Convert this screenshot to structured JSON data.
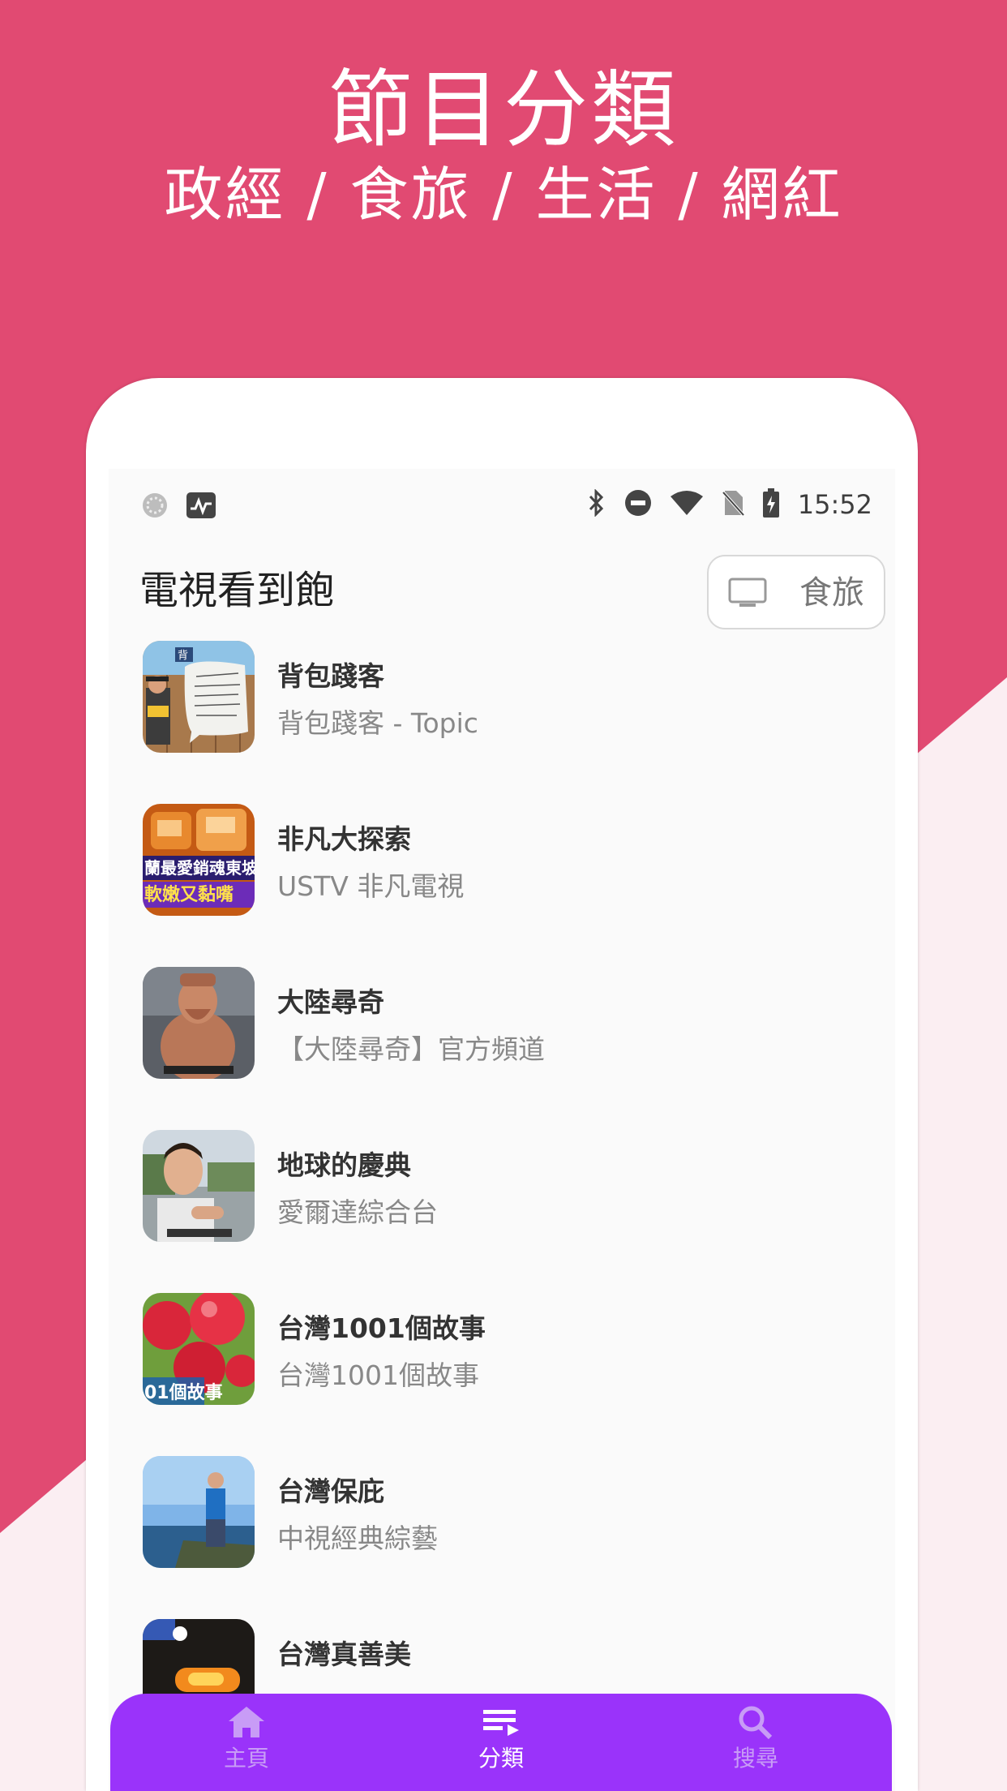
{
  "promo": {
    "title": "節目分類",
    "subtitle": "政經 / 食旅 / 生活 / 網紅"
  },
  "colors": {
    "brand_pink": "#e14a72",
    "light_pink": "#fbeef2",
    "nav_purple": "#9a33fa",
    "nav_inactive": "#c89cf6"
  },
  "status_bar": {
    "time": "15:52",
    "icons": [
      "sync-icon",
      "activity-icon",
      "bluetooth-icon",
      "do-not-disturb-icon",
      "wifi-icon",
      "no-sim-icon",
      "battery-charging-icon"
    ]
  },
  "app": {
    "title": "電視看到飽",
    "category_button": {
      "icon": "tv-icon",
      "label": "食旅"
    }
  },
  "programs": [
    {
      "title": "背包踐客",
      "channel": "背包踐客 - Topic"
    },
    {
      "title": "非凡大探索",
      "channel": "USTV 非凡電視"
    },
    {
      "title": "大陸尋奇",
      "channel": "【大陸尋奇】官方頻道"
    },
    {
      "title": "地球的慶典",
      "channel": "愛爾達綜合台"
    },
    {
      "title": "台灣1001個故事",
      "channel": "台灣1001個故事"
    },
    {
      "title": "台灣保庇",
      "channel": "中視經典綜藝"
    },
    {
      "title": "台灣真善美",
      "channel": ""
    }
  ],
  "thumb_text": {
    "t1_tag": "背",
    "t2_line1": "蘭最愛銷魂東坡",
    "t2_line2": "軟嫩又黏嘴",
    "t5_text": "01個故事"
  },
  "bottom_nav": {
    "items": [
      {
        "label": "主頁",
        "icon": "home-icon",
        "active": false
      },
      {
        "label": "分類",
        "icon": "list-icon",
        "active": true
      },
      {
        "label": "搜尋",
        "icon": "search-icon",
        "active": false
      }
    ]
  }
}
